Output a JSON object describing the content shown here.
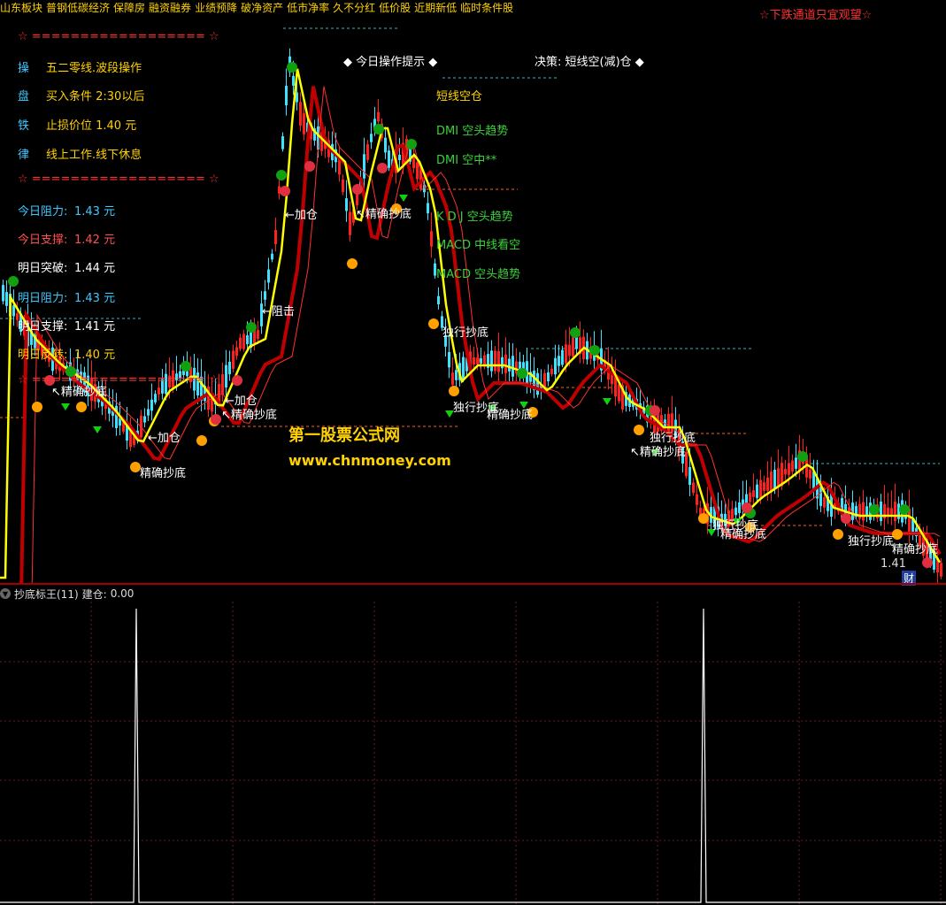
{
  "top_tags": [
    "山东板块",
    "普钢低碳经济",
    "保障房",
    "融资融券",
    "业绩预降",
    "破净资产",
    "低市净率",
    "久不分红",
    "低价股",
    "近期新低",
    "临时条件股"
  ],
  "warning": "☆下跌通道只宜观望☆",
  "left_panel": {
    "divider": "☆ ================== ☆",
    "rules": [
      {
        "key": "操",
        "text": "五二零线.波段操作"
      },
      {
        "key": "盘",
        "text": "买入条件 2:30以后"
      },
      {
        "key": "铁",
        "text": "止损价位 1.40 元"
      },
      {
        "key": "律",
        "text": "线上工作.线下休息"
      }
    ],
    "levels": [
      {
        "label": "今日阻力:",
        "value": "1.43 元",
        "color": "#40c8ff"
      },
      {
        "label": "今日支撑:",
        "value": "1.42 元",
        "color": "#ff5050"
      },
      {
        "label": "明日突破:",
        "value": "1.44 元",
        "color": "#ffffff"
      },
      {
        "label": "明日阻力:",
        "value": "1.43 元",
        "color": "#40c8ff"
      },
      {
        "label": "明日支撑:",
        "value": "1.41 元",
        "color": "#ffffff"
      },
      {
        "label": "明日反转:",
        "value": "1.40 元",
        "color": "#ffd200"
      }
    ]
  },
  "hint_title": "◆ 今日操作提示 ◆",
  "decision": "决策: 短线空(减)仓 ◆",
  "signals": [
    {
      "text": "短线空仓",
      "color": "#ffd200"
    },
    {
      "text": "DMI 空头趋势",
      "color": "#3ad23a"
    },
    {
      "text": "DMI 空中**",
      "color": "#3ad23a"
    },
    {
      "text": "K D J 空头趋势",
      "color": "#3ad23a"
    },
    {
      "text": "MACD 中线看空",
      "color": "#3ad23a"
    },
    {
      "text": "MACD 空头趋势",
      "color": "#3ad23a"
    }
  ],
  "annotations": [
    "←加仓",
    "←阻击",
    "↖精确抄底",
    "独行抄底",
    "精确抄底",
    "1.41",
    "财"
  ],
  "watermark": {
    "name": "第一股票公式网",
    "url": "www.chnmoney.com"
  },
  "indicator": {
    "name": "抄底标王(11)",
    "field": "建仓:",
    "value": "0.00"
  },
  "colors": {
    "up": "#ff2020",
    "down": "#40e0ff",
    "ma_fast": "#ffff00",
    "ma_slow": "#c00000",
    "buy": "#ffa000",
    "sell": "#10d010"
  }
}
